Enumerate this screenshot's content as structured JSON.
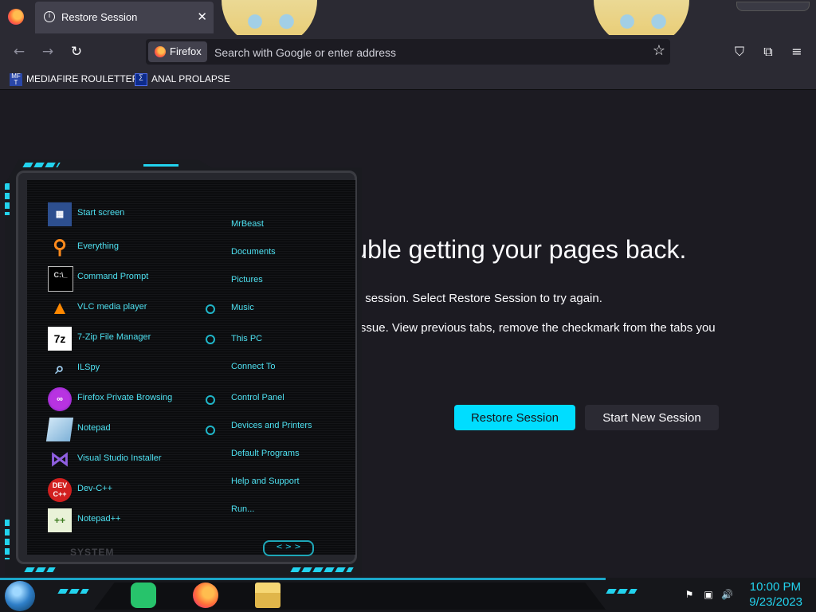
{
  "browser": {
    "tab_title": "Restore Session",
    "tab_close": "✕",
    "identity_label": "Firefox",
    "url_placeholder": "Search with Google or enter address",
    "bookmarks": [
      {
        "icon_text": "MF T",
        "label": "MEDIAFIRE ROULETTER"
      },
      {
        "icon_text": "∑",
        "label": "ANAL PROLAPSE"
      }
    ]
  },
  "page": {
    "headline": "Sorry. We're having trouble getting your pages back.",
    "line1": "We are having trouble restoring your last browsing session. Select Restore Session to try again.",
    "line2": "If you keep seeing this page, a tab is causing the issue. View previous tabs, remove the checkmark from the tabs you don't need to recover, and then restore.",
    "restore_button": "Restore Session",
    "new_session_button": "Start New Session"
  },
  "start_menu": {
    "apps": [
      {
        "icon": "start-screen-icon",
        "label": "Start screen"
      },
      {
        "icon": "everything-search-icon",
        "label": "Everything"
      },
      {
        "icon": "command-prompt-icon",
        "label": "Command Prompt"
      },
      {
        "icon": "vlc-icon",
        "label": "VLC media player"
      },
      {
        "icon": "7zip-icon",
        "label": "7-Zip File Manager"
      },
      {
        "icon": "ilspy-icon",
        "label": "ILSpy"
      },
      {
        "icon": "firefox-private-icon",
        "label": "Firefox Private Browsing"
      },
      {
        "icon": "notepad-icon",
        "label": "Notepad"
      },
      {
        "icon": "visual-studio-installer-icon",
        "label": "Visual Studio Installer"
      },
      {
        "icon": "dev-cpp-icon",
        "label": "Dev-C++"
      },
      {
        "icon": "notepad-plus-plus-icon",
        "label": "Notepad++"
      }
    ],
    "places": [
      "MrBeast",
      "Documents",
      "Pictures",
      "Music",
      "This PC",
      "Connect To",
      "Control Panel",
      "Devices and Printers",
      "Default Programs",
      "Help and Support",
      "Run..."
    ],
    "footer_label": "SYSTEM",
    "accent_color": "#22d3ee"
  },
  "taskbar": {
    "time": "10:00 PM",
    "date": "9/23/2023"
  },
  "colors": {
    "restore_button": "#00ddff",
    "page_bg": "#1c1b22",
    "toolbar_bg": "#2b2a33"
  }
}
